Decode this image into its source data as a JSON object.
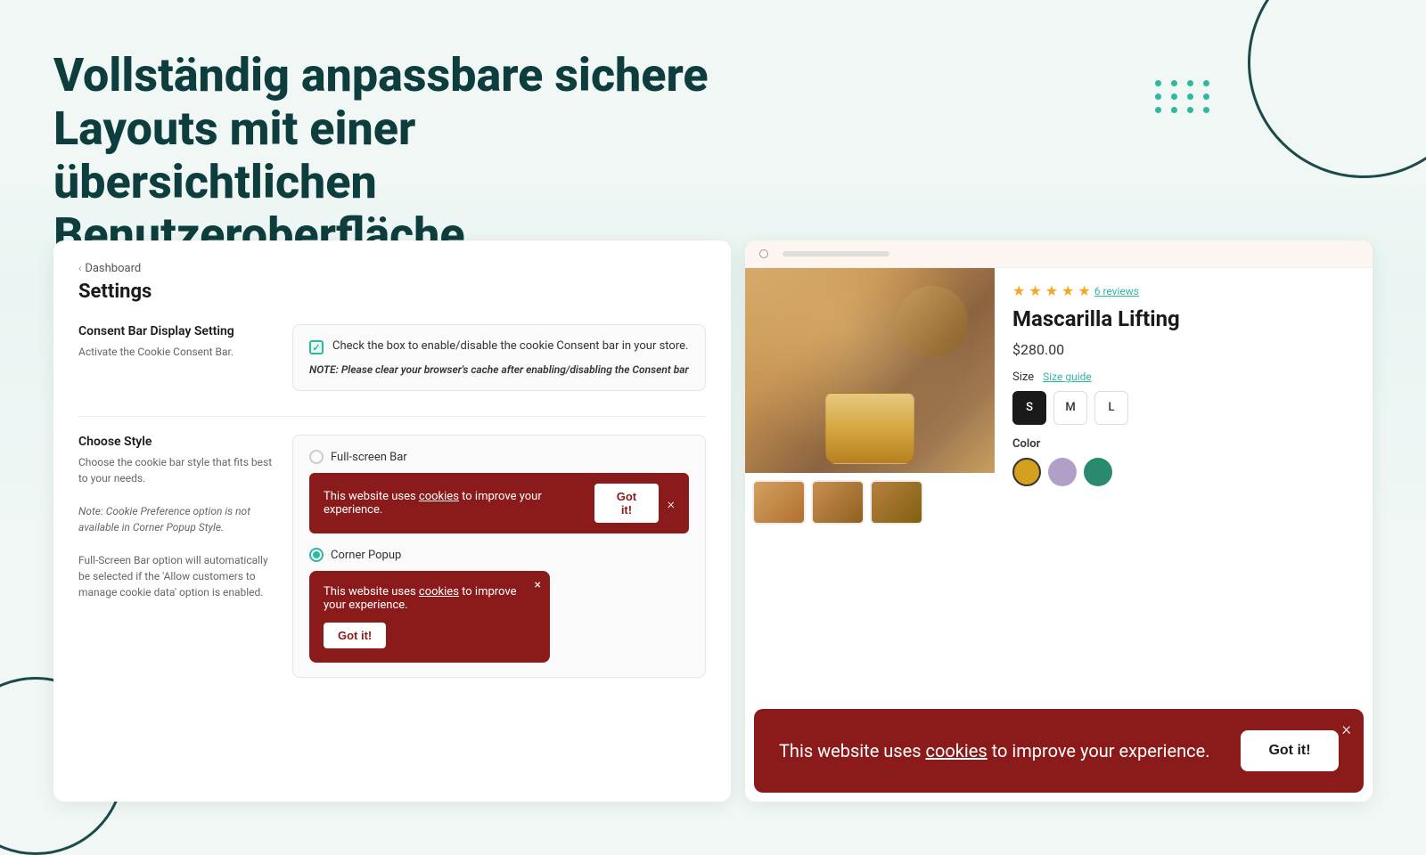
{
  "hero": {
    "title": "Vollständig anpassbare sichere Layouts mit einer übersichtlichen Benutzeroberfläche."
  },
  "decorative": {
    "dots_count": 12
  },
  "settings": {
    "breadcrumb": "Dashboard",
    "title": "Settings",
    "consent_bar_section": {
      "label": "Consent Bar Display Setting",
      "description": "Activate the Cookie Consent Bar.",
      "checkbox_label": "Check the box to enable/disable the cookie Consent bar in your store.",
      "note": "NOTE: Please clear your browser's cache after enabling/disabling the Consent bar",
      "is_checked": true
    },
    "choose_style_section": {
      "label": "Choose Style",
      "description": "Choose the cookie bar style that fits best to your needs.",
      "note1": "Note: Cookie Preference option is not available in Corner Popup Style.",
      "note2": "Full-Screen Bar option will automatically be selected if the 'Allow customers to manage cookie data' option is enabled.",
      "options": [
        {
          "value": "fullscreen",
          "label": "Full-screen Bar",
          "selected": false
        },
        {
          "value": "corner-popup",
          "label": "Corner Popup",
          "selected": true
        }
      ],
      "fullscreen_preview": {
        "text": "This website uses",
        "link_text": "cookies",
        "text2": "to improve your experience.",
        "button_label": "Got it!",
        "close_symbol": "×"
      },
      "popup_preview": {
        "text": "This website uses",
        "link_text": "cookies",
        "text2": "to improve your experience.",
        "button_label": "Got it!",
        "close_symbol": "×"
      }
    }
  },
  "product": {
    "tab_indicator": "○",
    "stars": [
      "★",
      "★",
      "★",
      "★",
      "★"
    ],
    "half_star": "",
    "reviews_label": "6 reviews",
    "name": "Mascarilla Lifting",
    "price": "$280.00",
    "size_label": "Size",
    "size_guide_label": "Size guide",
    "sizes": [
      "S",
      "M",
      "L"
    ],
    "selected_size": "S",
    "color_label": "Color",
    "colors": [
      {
        "name": "yellow",
        "hex": "#d4a020"
      },
      {
        "name": "lavender",
        "hex": "#b0a0c8"
      },
      {
        "name": "teal",
        "hex": "#2a8a70"
      }
    ]
  },
  "cookie_overlay": {
    "text_before_link": "This website uses",
    "link_text": "cookies",
    "text_after_link": "to improve your experience.",
    "button_label": "Got it!",
    "close_symbol": "×"
  }
}
